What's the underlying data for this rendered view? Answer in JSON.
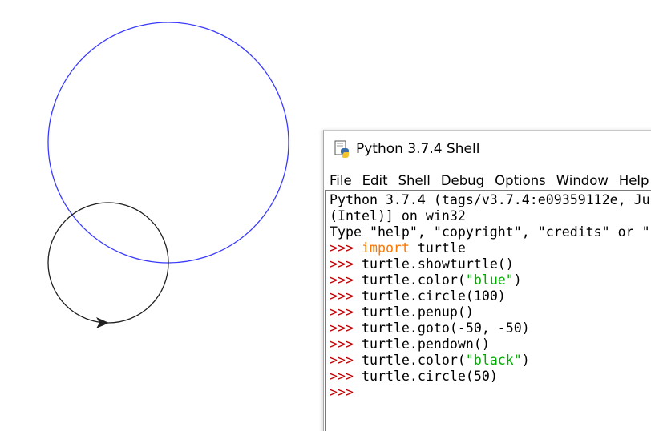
{
  "colors": {
    "circle_big": "#3a3aff",
    "circle_small": "#202020",
    "prompt": "#c00000",
    "keyword": "#ff7700",
    "string": "#00aa00",
    "text": "#000000"
  },
  "turtle": {
    "icons": [
      "turtle-arrow-icon"
    ]
  },
  "shell": {
    "title": "Python 3.7.4 Shell",
    "icon": "python-idle-icon",
    "menu": [
      "File",
      "Edit",
      "Shell",
      "Debug",
      "Options",
      "Window",
      "Help"
    ],
    "banner": [
      "Python 3.7.4 (tags/v3.7.4:e09359112e, Ju",
      "(Intel)] on win32",
      "Type \"help\", \"copyright\", \"credits\" or \""
    ],
    "prompt": ">>> ",
    "commands": [
      {
        "parts": [
          {
            "t": "kw",
            "v": "import"
          },
          {
            "t": "plain",
            "v": " turtle"
          }
        ]
      },
      {
        "parts": [
          {
            "t": "plain",
            "v": "turtle.showturtle()"
          }
        ]
      },
      {
        "parts": [
          {
            "t": "plain",
            "v": "turtle.color("
          },
          {
            "t": "str",
            "v": "\"blue\""
          },
          {
            "t": "plain",
            "v": ")"
          }
        ]
      },
      {
        "parts": [
          {
            "t": "plain",
            "v": "turtle.circle(100)"
          }
        ]
      },
      {
        "parts": [
          {
            "t": "plain",
            "v": "turtle.penup()"
          }
        ]
      },
      {
        "parts": [
          {
            "t": "plain",
            "v": "turtle.goto(-50, -50)"
          }
        ]
      },
      {
        "parts": [
          {
            "t": "plain",
            "v": "turtle.pendown()"
          }
        ]
      },
      {
        "parts": [
          {
            "t": "plain",
            "v": "turtle.color("
          },
          {
            "t": "str",
            "v": "\"black\""
          },
          {
            "t": "plain",
            "v": ")"
          }
        ]
      },
      {
        "parts": [
          {
            "t": "plain",
            "v": "turtle.circle(50)"
          }
        ]
      }
    ],
    "final_prompt": ">>>"
  }
}
